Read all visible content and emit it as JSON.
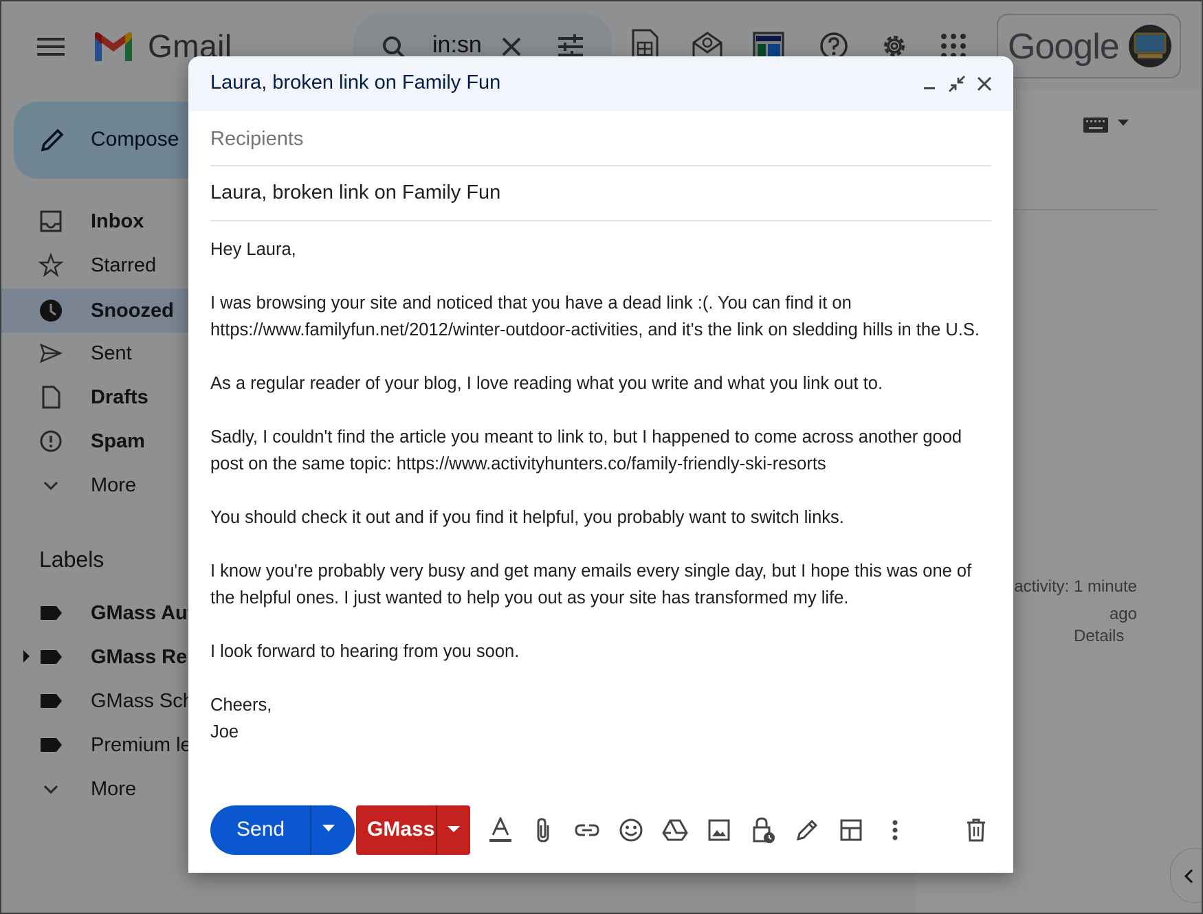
{
  "background": {
    "app_name": "Gmail",
    "search_query": "in:sn",
    "google_logo": "Google",
    "compose_label": "Compose",
    "nav": [
      {
        "label": "Inbox",
        "icon": "inbox-icon",
        "bold": true
      },
      {
        "label": "Starred",
        "icon": "star-icon",
        "bold": false
      },
      {
        "label": "Snoozed",
        "icon": "clock-icon",
        "bold": true,
        "selected": true
      },
      {
        "label": "Sent",
        "icon": "send-icon",
        "bold": false
      },
      {
        "label": "Drafts",
        "icon": "draft-icon",
        "bold": true
      },
      {
        "label": "Spam",
        "icon": "spam-icon",
        "bold": true
      },
      {
        "label": "More",
        "icon": "chevron-down-icon",
        "bold": false
      }
    ],
    "labels_heading": "Labels",
    "labels": [
      {
        "label": "GMass Aut",
        "bold": true
      },
      {
        "label": "GMass Rep",
        "bold": true,
        "expandable": true
      },
      {
        "label": "GMass Sch",
        "bold": false
      },
      {
        "label": "Premium le",
        "bold": false
      }
    ],
    "labels_more": "More",
    "activity_text": "activity: 1 minute ago",
    "details_link": "Details"
  },
  "compose": {
    "title": "Laura, broken link on Family Fun",
    "recipients_placeholder": "Recipients",
    "subject": "Laura, broken link on Family Fun",
    "body": {
      "greeting": "Hey Laura,",
      "p1": "I was browsing your site and noticed that you have a dead link :(. You can find it on https://www.familyfun.net/2012/winter-outdoor-activities, and it's the link on sledding hills in the U.S.",
      "p2": "As a regular reader of your blog, I love reading what you write and what you link out to.",
      "p3": "Sadly, I couldn't find the article you meant to link to, but I happened to come across another good post on the same topic: https://www.activityhunters.co/family-friendly-ski-resorts",
      "p4": "You should check it out and if you find it helpful, you probably want to switch links.",
      "p5": "I know you're probably very busy and get many emails every single day, but I hope this was one of the helpful ones. I just wanted to help you out as your site has transformed my life.",
      "p6": "I look forward to hearing from you soon.",
      "signoff": "Cheers,",
      "name": "Joe"
    },
    "send_label": "Send",
    "gmass_label": "GMass"
  },
  "colors": {
    "send_blue": "#0b57d0",
    "gmass_red": "#c5221f",
    "header_bg": "#f2f6fc",
    "compose_bg": "#c2e7ff"
  }
}
